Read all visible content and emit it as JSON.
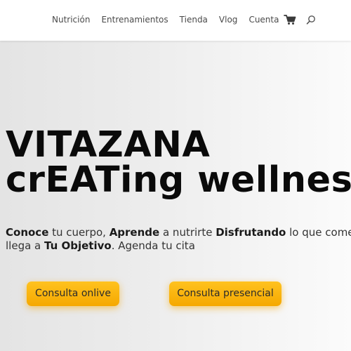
{
  "nav": {
    "items": [
      "Nutrición",
      "Entrenamientos",
      "Tienda",
      "Vlog",
      "Cuenta"
    ],
    "cart_icon": "shopping-cart-icon",
    "search_icon": "search-icon"
  },
  "hero": {
    "title_line1": "VITAZANA",
    "title_line2": "crEATing wellness",
    "text": {
      "w1": "Conoce",
      "t1": " tu cuerpo, ",
      "w2": "Aprende",
      "t2": " a nutrirte ",
      "w3": "Disfrutando",
      "t3": " lo que comes",
      "t4": "llega a ",
      "w4": "Tu Objetivo",
      "t5": ". Agenda tu cita"
    }
  },
  "buttons": {
    "online": "Consulta onlive",
    "presencial": "Consulta presencial"
  },
  "colors": {
    "accent": "#f7b100",
    "title": "#0a0a0a",
    "nav_text": "#4a4a4a"
  }
}
